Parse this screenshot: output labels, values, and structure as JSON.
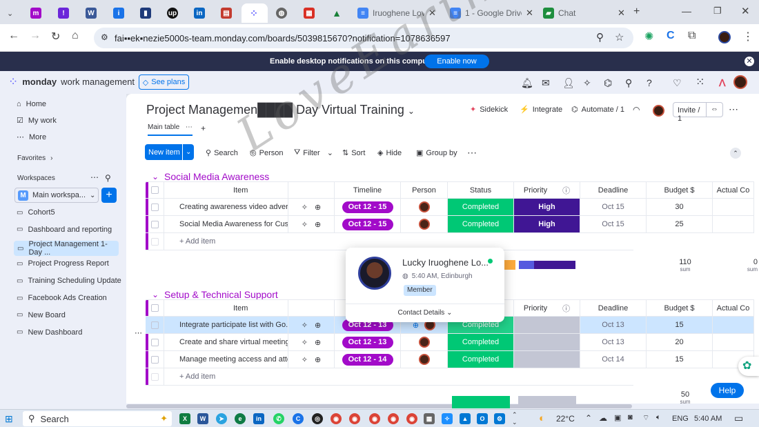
{
  "browser": {
    "tabs": [
      {
        "label": "",
        "icon": "monday-icon",
        "color": "#a20bc9"
      },
      {
        "label": "",
        "icon": "exclaim-icon",
        "color": "#6b26d9"
      },
      {
        "label": "",
        "icon": "w-icon",
        "color": "#3b5998"
      },
      {
        "label": "",
        "icon": "info-icon",
        "color": "#1a73e8"
      },
      {
        "label": "",
        "icon": "doc-icon",
        "color": "#1f3b7a"
      },
      {
        "label": "",
        "icon": "upwork-icon",
        "color": "#111"
      },
      {
        "label": "",
        "icon": "linkedin-icon",
        "color": "#0a66c2"
      },
      {
        "label": "",
        "icon": "book-icon",
        "color": "#c33b2f"
      },
      {
        "label": "",
        "icon": "monday-icon",
        "color": "#6161ff"
      },
      {
        "label": "",
        "icon": "globe-icon",
        "color": "#555"
      },
      {
        "label": "",
        "icon": "calendar-icon",
        "color": "#d93025"
      },
      {
        "label": "",
        "icon": "drive-icon",
        "color": "#188038"
      },
      {
        "label": "Iruoghene Love",
        "icon": "gdoc-icon",
        "color": "#4285f4"
      },
      {
        "label": "1 - Google Drive",
        "icon": "gdoc-icon",
        "color": "#4285f4"
      },
      {
        "label": "Chat",
        "icon": "chat-icon",
        "color": "#1e8e3e"
      }
    ],
    "url": "fai▪▪ek▪nezie5000s-team.monday.com/boards/5039815670?notification=1078636597"
  },
  "notification": {
    "message": "Enable desktop notifications on this computer",
    "button": "Enable now"
  },
  "header": {
    "brand": "monday",
    "brand_sub": "work management",
    "see_plans": "See plans"
  },
  "sidebar": {
    "top": [
      {
        "label": "Home",
        "icon": "home-icon"
      },
      {
        "label": "My work",
        "icon": "mywork-icon"
      },
      {
        "label": "More",
        "icon": "more-icon"
      }
    ],
    "favorites": "Favorites",
    "workspaces": "Workspaces",
    "workspace_name": "Main workspa...",
    "workspace_initial": "M",
    "boards": [
      "Cohort5",
      "Dashboard and reporting",
      "Project Management 1-Day ...",
      "Project Progress Report",
      "Training Scheduling Update",
      "Facebook Ads Creation",
      "New Board",
      "New Dashboard"
    ]
  },
  "board": {
    "title": "Project Managemen████ Day Virtual Training",
    "main_table": "Main table",
    "sidekick": "Sidekick",
    "integrate": "Integrate",
    "automate": "Automate / 1",
    "invite": "Invite / 1",
    "toolbar": {
      "new_item": "New item",
      "search": "Search",
      "person": "Person",
      "filter": "Filter",
      "sort": "Sort",
      "hide": "Hide",
      "group_by": "Group by"
    },
    "columns": [
      "Item",
      "Timeline",
      "Person",
      "Status",
      "Priority",
      "Deadline",
      "Budget $",
      "Actual Co"
    ],
    "groups": [
      {
        "title": "Social Media Awareness",
        "color": "#a20bc9",
        "rows": [
          {
            "item": "Creating awareness video advert...",
            "timeline": "Oct 12 - 15",
            "status": "Completed",
            "priority": "High",
            "deadline": "Oct 15",
            "budget": "30"
          },
          {
            "item": "Social Media Awareness for Cust...",
            "timeline": "Oct 12 - 15",
            "status": "Completed",
            "priority": "High",
            "deadline": "Oct 15",
            "budget": "25"
          }
        ],
        "add_item": "+ Add item",
        "sum_budget": "110",
        "sum_actual": "0",
        "sum_label": "sum"
      },
      {
        "title": "Setup & Technical Support",
        "color": "#a20bc9",
        "rows": [
          {
            "item": "Integrate participate list with Go...",
            "timeline": "Oct 12 - 13",
            "status": "Completed",
            "priority": "",
            "deadline": "Oct 13",
            "budget": "15"
          },
          {
            "item": "Create and share virtual meeting ...",
            "timeline": "Oct 12 - 13",
            "status": "Completed",
            "priority": "",
            "deadline": "Oct 13",
            "budget": "20"
          },
          {
            "item": "Manage meeting access and atte...",
            "timeline": "Oct 12 - 14",
            "status": "Completed",
            "priority": "",
            "deadline": "Oct 14",
            "budget": "15"
          }
        ],
        "add_item": "+ Add item",
        "sum_budget": "50",
        "sum_label": "sum"
      }
    ]
  },
  "popup": {
    "name": "Lucky Iruoghene Lo...",
    "time": "5:40 AM, Edinburgh",
    "role": "Member",
    "contact": "Contact Details"
  },
  "help": "Help",
  "watermark": "LoveEarth's",
  "taskbar": {
    "search": "Search",
    "weather": "22°C",
    "lang": "ENG",
    "clock": "5:40 AM"
  }
}
